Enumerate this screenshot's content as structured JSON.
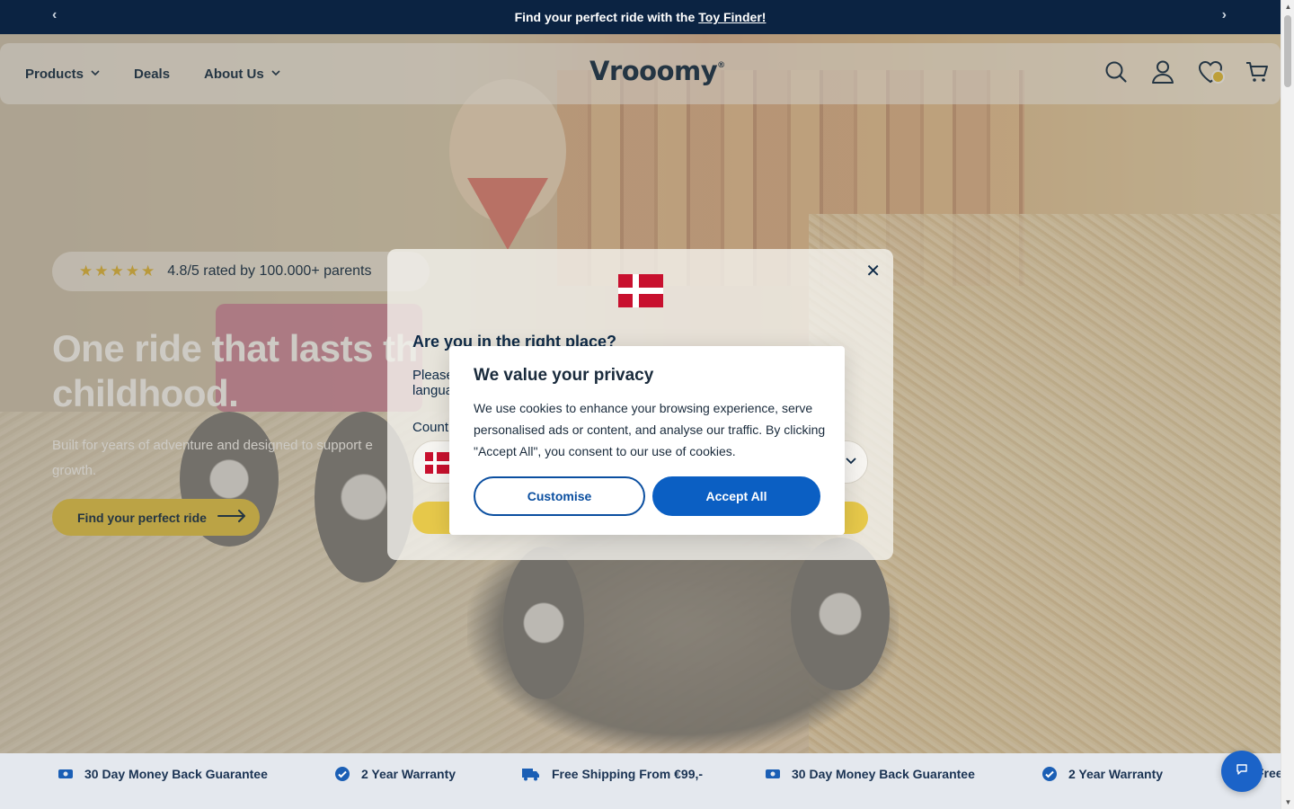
{
  "announcement": {
    "text": "Find your perfect ride with the",
    "link": "Toy Finder!",
    "prev_arrow": "‹",
    "next_arrow": "›"
  },
  "header": {
    "nav": [
      {
        "label": "Products",
        "has_dropdown": true
      },
      {
        "label": "Deals",
        "has_dropdown": false
      },
      {
        "label": "About Us",
        "has_dropdown": true
      }
    ],
    "logo": "Vrooomy",
    "logo_mark": "®",
    "icons": [
      "search-icon",
      "account-icon",
      "wishlist-icon",
      "cart-icon"
    ]
  },
  "hero": {
    "rating_stars": "★★★★★",
    "rating_text": "4.8/5 rated by 100.000+ parents",
    "title": "One ride that lasts th",
    "title_line2": "childhood.",
    "subtitle": "Built for years of adventure and designed to support e",
    "subtitle_line2": "growth.",
    "cta_label": "Find your perfect ride"
  },
  "country_modal": {
    "title": "Are you in the right place?",
    "text_line1": "Please",
    "text_line2": "langua",
    "country_label": "Count",
    "close": "✕"
  },
  "privacy": {
    "title": "We value your privacy",
    "body": "We use cookies to enhance your browsing experience, serve personalised ads or content, and analyse our traffic. By clicking \"Accept All\", you consent to our use of cookies.",
    "customise_label": "Customise",
    "accept_label": "Accept All"
  },
  "usp": [
    {
      "icon": "money-icon",
      "label": "30 Day Money Back Guarantee"
    },
    {
      "icon": "check-badge-icon",
      "label": "2 Year Warranty"
    },
    {
      "icon": "truck-icon",
      "label": "Free Shipping From €99,-"
    },
    {
      "icon": "money-icon",
      "label": "30 Day Money Back Guarantee"
    },
    {
      "icon": "check-badge-icon",
      "label": "2 Year Warranty"
    },
    {
      "icon": "truck-icon",
      "label": "Free"
    }
  ],
  "colors": {
    "announcement_bg": "#0b2342",
    "brand_navy": "#0e2a47",
    "cta_yellow": "#e6c84a",
    "accept_blue": "#0b5fc3",
    "usp_bg": "#e4e8ee"
  }
}
